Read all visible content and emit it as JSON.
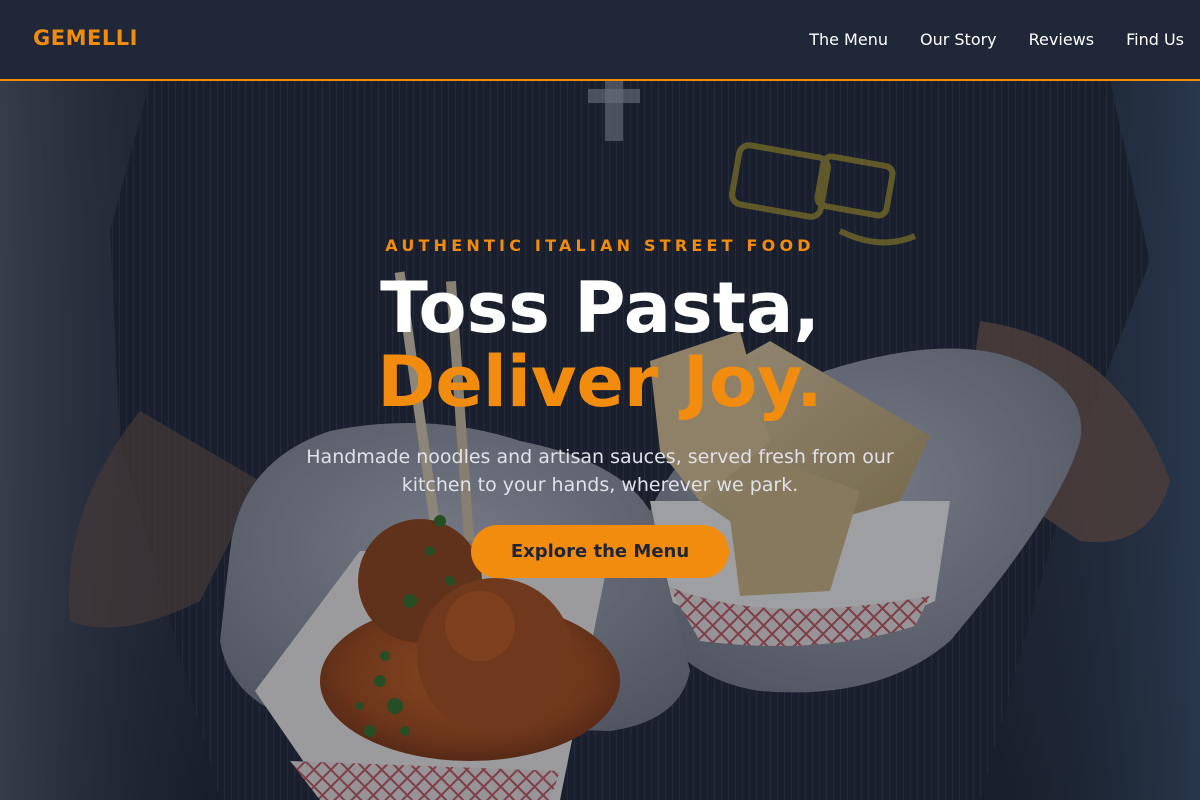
{
  "nav": {
    "brand": "GEMELLI",
    "links": [
      "The Menu",
      "Our Story",
      "Reviews",
      "Find Us"
    ]
  },
  "hero": {
    "kicker": "AUTHENTIC ITALIAN STREET FOOD",
    "headline_line1": "Toss Pasta,",
    "headline_line2": "Deliver Joy.",
    "subtitle": "Handmade noodles and artisan sauces, served fresh from our kitchen to your hands, wherever we park.",
    "cta_label": "Explore the Menu",
    "background_image": "Gloved hands holding two paper food boats — meatballs in tomato sauce with herbs and crispy fried ravioli — in front of a chef in a dark striped apron"
  },
  "colors": {
    "accent": "#f28c0f",
    "nav_bg": "#1f2739",
    "text_light": "#ffffff",
    "text_muted": "#e0e2e8",
    "button_text": "#1e2536"
  }
}
